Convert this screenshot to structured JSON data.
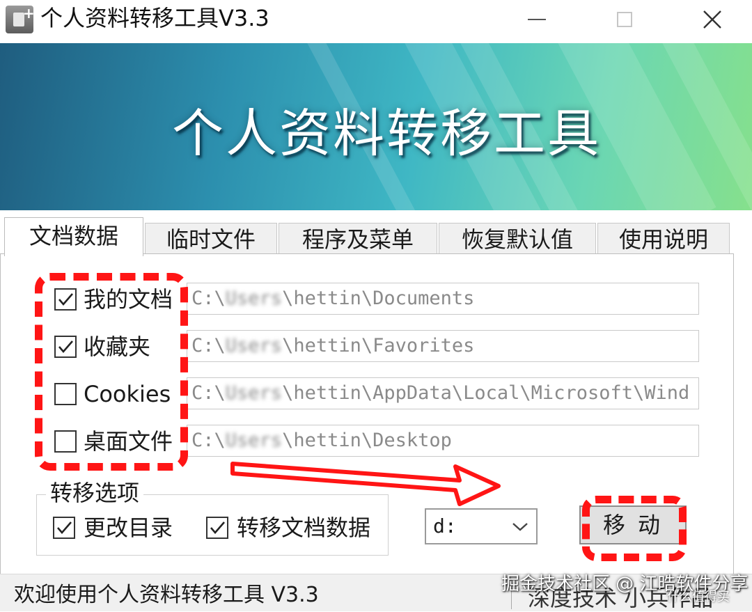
{
  "window": {
    "title": "个人资料转移工具V3.3",
    "icon": "app-icon"
  },
  "banner": {
    "title": "个人资料转移工具"
  },
  "tabs": [
    {
      "label": "文档数据",
      "active": true
    },
    {
      "label": "临时文件",
      "active": false
    },
    {
      "label": "程序及菜单",
      "active": false
    },
    {
      "label": "恢复默认值",
      "active": false
    },
    {
      "label": "使用说明",
      "active": false
    }
  ],
  "items": [
    {
      "label": "我的文档",
      "checked": true,
      "path_pre": "C:\\",
      "path_blur": "Users",
      "path_post": "\\hettin\\Documents"
    },
    {
      "label": "收藏夹",
      "checked": true,
      "path_pre": "C:\\",
      "path_blur": "Users",
      "path_post": "\\hettin\\Favorites"
    },
    {
      "label": "Cookies",
      "checked": false,
      "path_pre": "C:\\",
      "path_blur": "Users",
      "path_post": "\\hettin\\AppData\\Local\\Microsoft\\Wind"
    },
    {
      "label": "桌面文件",
      "checked": false,
      "path_pre": "C:\\",
      "path_blur": "Users",
      "path_post": "\\hettin\\Desktop"
    }
  ],
  "options": {
    "group_title": "转移选项",
    "change_dir": {
      "label": "更改目录",
      "checked": true
    },
    "transfer_docs": {
      "label": "转移文档数据",
      "checked": true
    }
  },
  "drive": {
    "value": "d:"
  },
  "move_button": {
    "label": "移动"
  },
  "status": {
    "left": "欢迎使用个人资料转移工具 V3.3",
    "right": "深度技术 小兵作品"
  },
  "watermark": {
    "line1": "掘金技术社区 @ 江晧软件分享",
    "line2": "什么值得买"
  },
  "annotation_color": "#ff1515"
}
